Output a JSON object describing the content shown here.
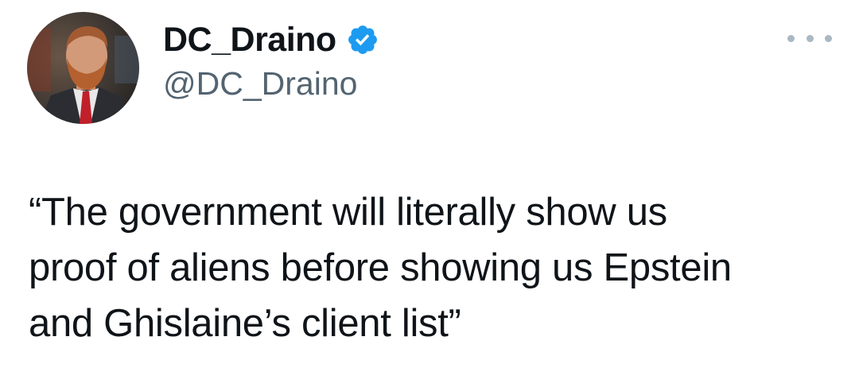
{
  "author": {
    "display_name": "DC_Draino",
    "handle": "@DC_Draino",
    "verified": true,
    "verified_color": "#1d9bf0"
  },
  "icons": {
    "verified": "verified-badge-icon",
    "more": "more-options-icon"
  },
  "tweet": {
    "text_lines": [
      "“The government will literally show us",
      "proof of aliens before showing us Epstein",
      "and Ghislaine’s client list”"
    ]
  }
}
